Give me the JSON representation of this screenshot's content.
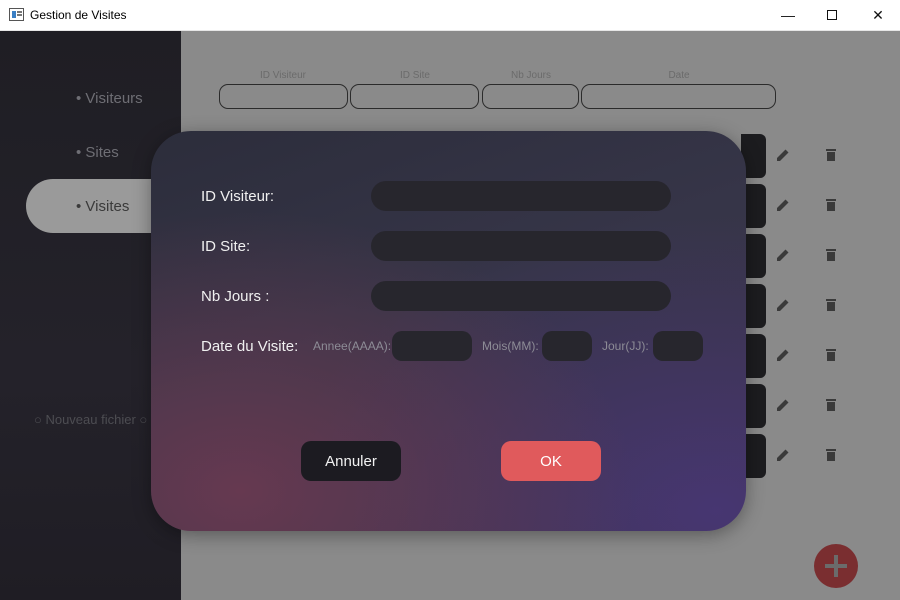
{
  "window": {
    "title": "Gestion de Visites",
    "minimize_glyph": "—",
    "close_glyph": "✕"
  },
  "sidebar": {
    "items": [
      {
        "label": "• Visiteurs",
        "active": false
      },
      {
        "label": "• Sites",
        "active": false
      },
      {
        "label": "• Visites",
        "active": true
      }
    ],
    "new_file": "○ Nouveau fichier ○"
  },
  "filters": {
    "id_visiteur": "ID Visiteur",
    "id_site": "ID Site",
    "nb_jours": "Nb Jours",
    "date": "Date"
  },
  "dialog": {
    "labels": {
      "id_visiteur": "ID Visiteur:",
      "id_site": "ID Site:",
      "nb_jours": "Nb Jours :",
      "date": "Date du Visite:"
    },
    "fields": {
      "id_visiteur": "",
      "id_site": "",
      "nb_jours": "",
      "annee": "",
      "mois": "",
      "jour": ""
    },
    "date_parts": {
      "annee": "Annee(AAAA):",
      "mois": "Mois(MM):",
      "jour": "Jour(JJ):"
    },
    "buttons": {
      "cancel": "Annuler",
      "ok": "OK"
    }
  },
  "colors": {
    "accent_ok": "#e05a5c",
    "sidebar_bg": "#1f1e24",
    "field_bg": "#27262d",
    "fab": "#7a2e30"
  },
  "icons": {
    "edit": "pencil-icon",
    "delete": "trash-icon",
    "add": "plus-icon"
  }
}
